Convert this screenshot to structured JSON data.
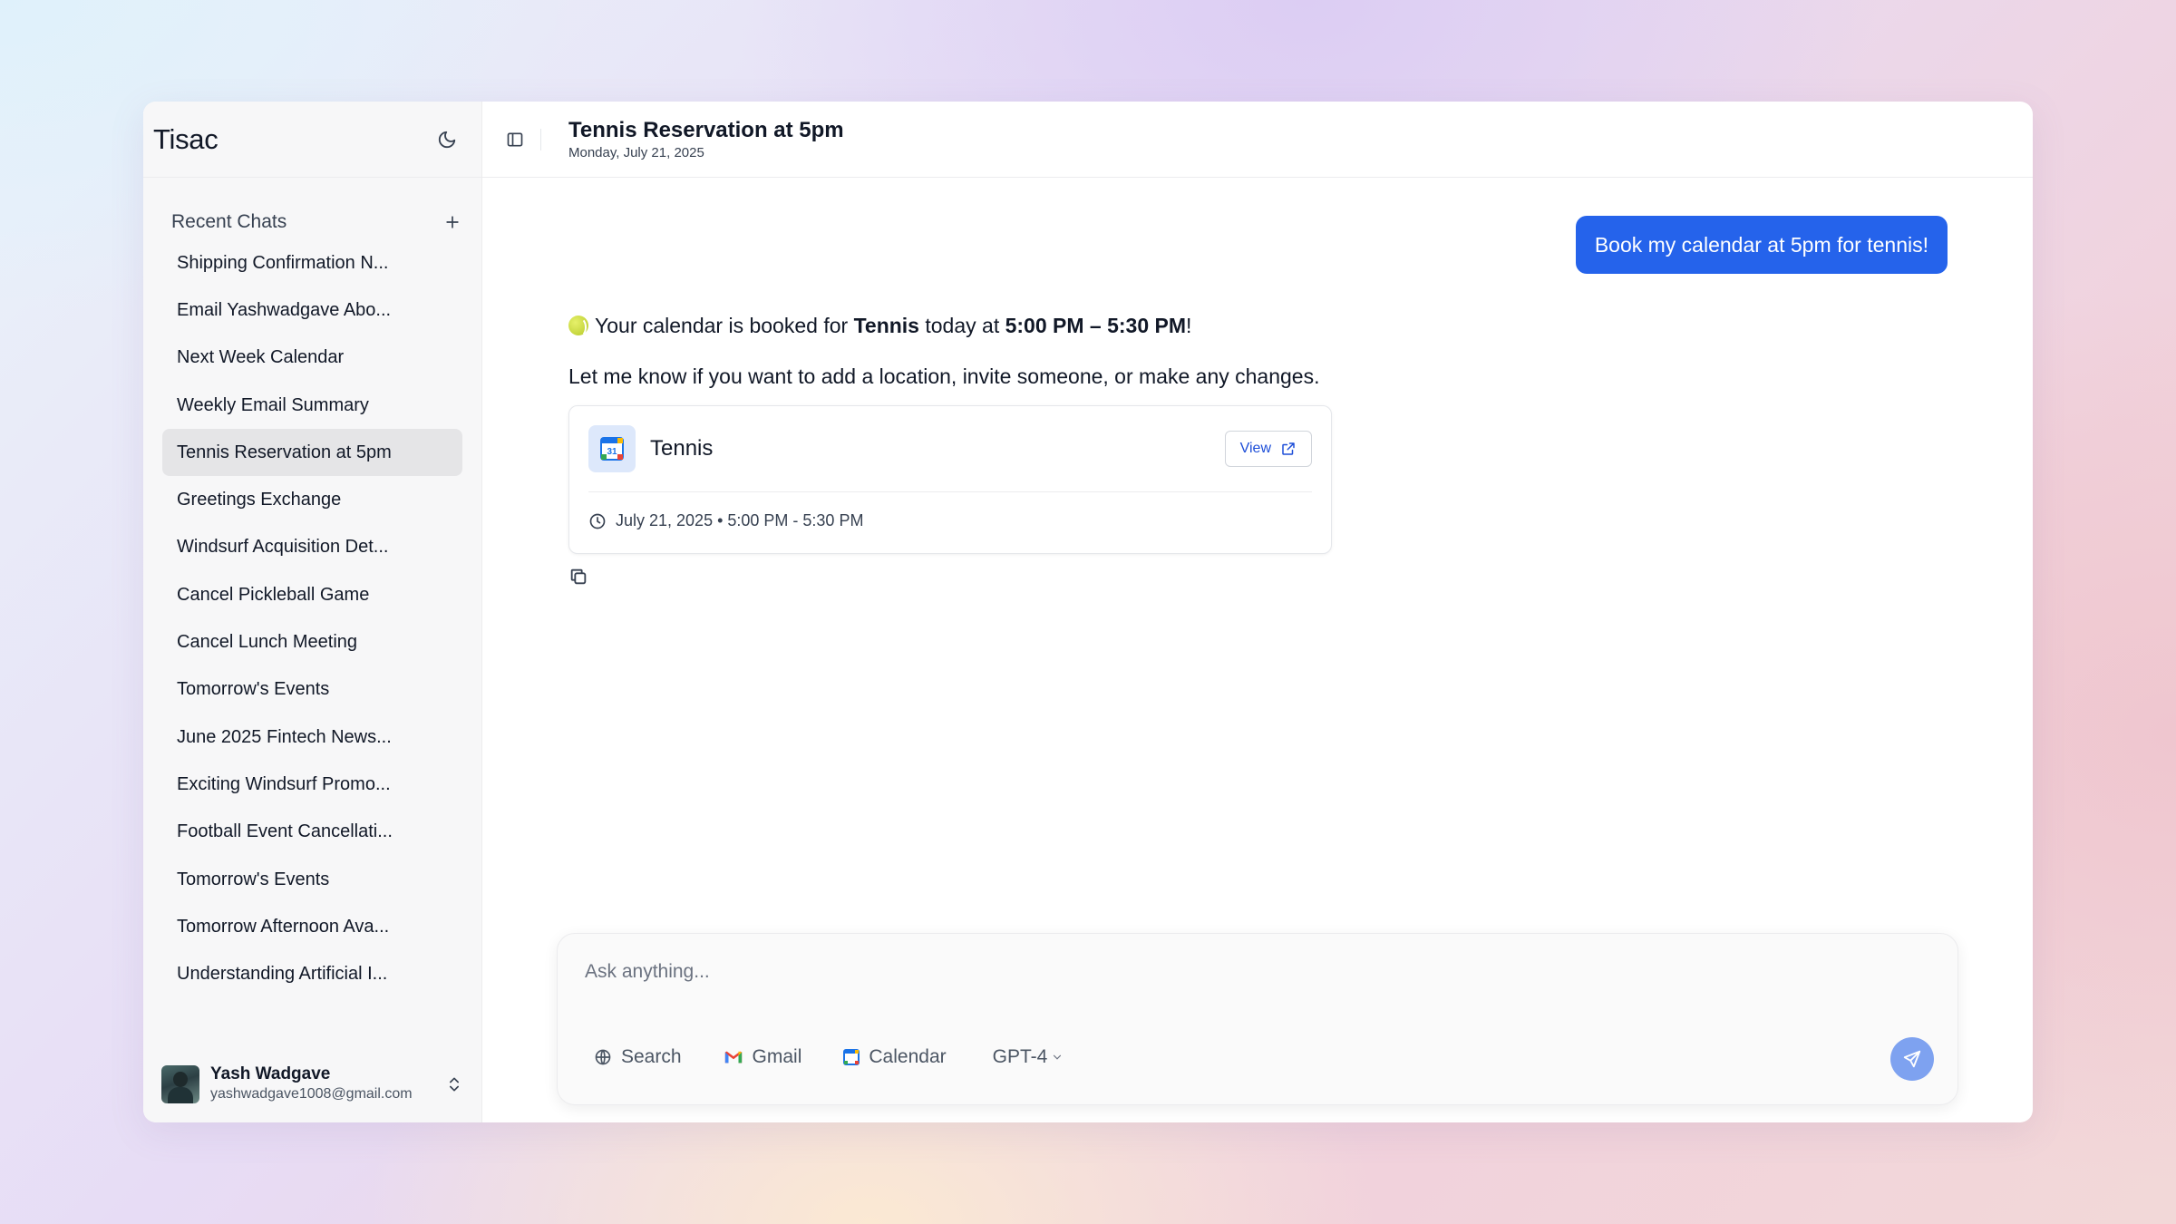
{
  "sidebar": {
    "brand": "Tisac",
    "recent_title": "Recent Chats",
    "items": [
      {
        "label": "Shipping Confirmation N..."
      },
      {
        "label": "Email Yashwadgave Abo..."
      },
      {
        "label": "Next Week Calendar"
      },
      {
        "label": "Weekly Email Summary"
      },
      {
        "label": "Tennis Reservation at 5pm",
        "active": true
      },
      {
        "label": "Greetings Exchange"
      },
      {
        "label": "Windsurf Acquisition Det..."
      },
      {
        "label": "Cancel Pickleball Game"
      },
      {
        "label": "Cancel Lunch Meeting"
      },
      {
        "label": "Tomorrow's Events"
      },
      {
        "label": "June 2025 Fintech News..."
      },
      {
        "label": "Exciting Windsurf Promo..."
      },
      {
        "label": "Football Event Cancellati..."
      },
      {
        "label": "Tomorrow's Events"
      },
      {
        "label": "Tomorrow Afternoon Ava..."
      },
      {
        "label": "Understanding Artificial I..."
      }
    ],
    "user": {
      "name": "Yash Wadgave",
      "email": "yashwadgave1008@gmail.com"
    }
  },
  "header": {
    "title": "Tennis Reservation at 5pm",
    "date": "Monday, July 21, 2025"
  },
  "conversation": {
    "user_message": "Book my calendar at 5pm for tennis!",
    "assistant": {
      "line1_prefix": "Your calendar is booked for ",
      "line1_event": "Tennis",
      "line1_middle": " today at ",
      "line1_time": "5:00 PM – 5:30 PM",
      "line1_suffix": "!",
      "line2": "Let me know if you want to add a location, invite someone, or make any changes.",
      "event_card": {
        "name": "Tennis",
        "view_label": "View",
        "time": "July 21, 2025 • 5:00 PM - 5:30 PM"
      }
    }
  },
  "composer": {
    "placeholder": "Ask anything...",
    "tools": [
      {
        "label": "Search",
        "icon": "globe-icon"
      },
      {
        "label": "Gmail",
        "icon": "gmail-icon"
      },
      {
        "label": "Calendar",
        "icon": "calendar-icon"
      }
    ],
    "model": "GPT-4"
  },
  "colors": {
    "accent": "#2563eb",
    "send_button": "#7ea2f0",
    "active_item": "#e5e5e7"
  }
}
